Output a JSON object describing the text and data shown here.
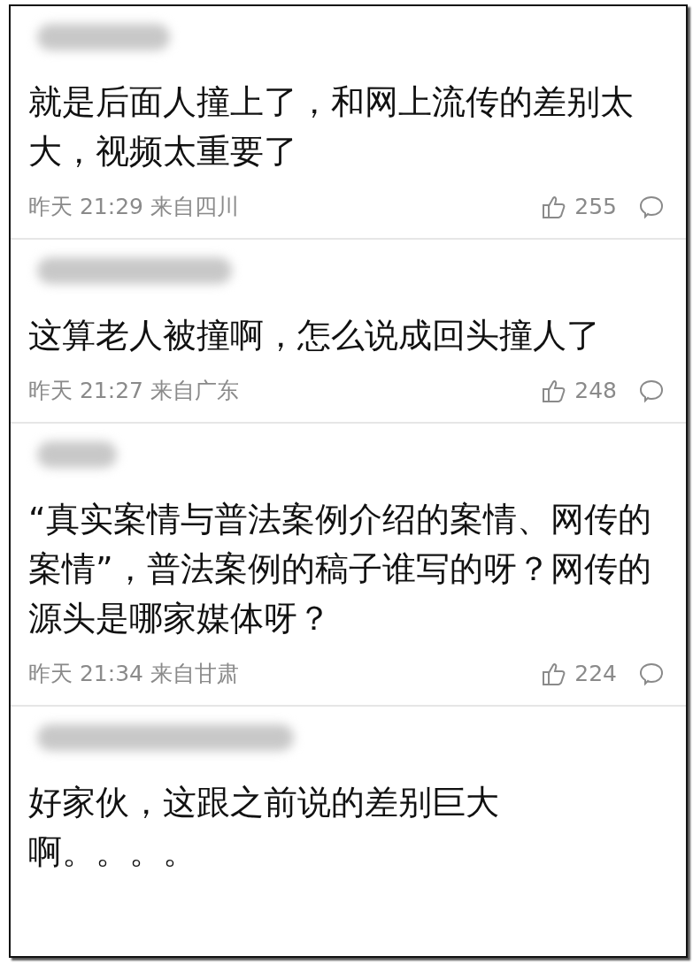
{
  "comments": [
    {
      "text": "就是后面人撞上了，和网上流传的差别太大，视频太重要了",
      "time": "昨天 21:29",
      "location": "来自四川",
      "likes": "255"
    },
    {
      "text": "这算老人被撞啊，怎么说成回头撞人了",
      "time": "昨天 21:27",
      "location": "来自广东",
      "likes": "248"
    },
    {
      "text": "“真实案情与普法案例介绍的案情、网传的案情”，普法案例的稿子谁写的呀？网传的源头是哪家媒体呀？",
      "time": "昨天 21:34",
      "location": "来自甘肃",
      "likes": "224"
    },
    {
      "text": "好家伙，这跟之前说的差别巨大啊。。。。"
    }
  ]
}
